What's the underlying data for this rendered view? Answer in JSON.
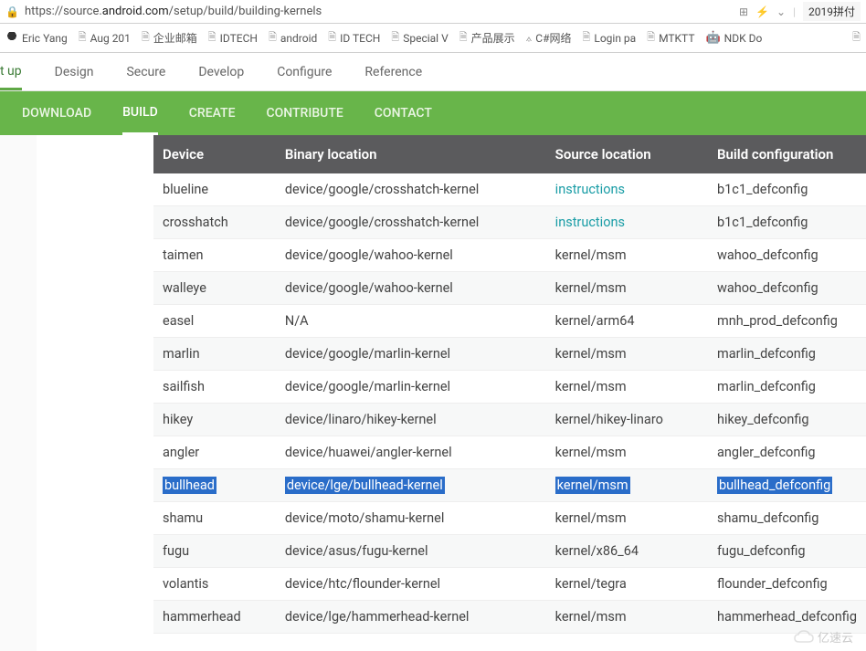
{
  "address_bar": {
    "url_prefix": "https://source.",
    "url_domain": "android.com",
    "url_suffix": "/setup/build/building-kernels",
    "right_badge": "2019拼付"
  },
  "bookmarks": [
    {
      "label": "Eric Yang",
      "icon": "eric"
    },
    {
      "label": "Aug 201",
      "icon": "file"
    },
    {
      "label": "企业邮箱",
      "icon": "file"
    },
    {
      "label": "IDTECH",
      "icon": "file"
    },
    {
      "label": "android",
      "icon": "file"
    },
    {
      "label": "ID TECH",
      "icon": "file"
    },
    {
      "label": "Special V",
      "icon": "file"
    },
    {
      "label": "产品展示",
      "icon": "file"
    },
    {
      "label": "C#网络",
      "icon": "csharp"
    },
    {
      "label": "Login pa",
      "icon": "file"
    },
    {
      "label": "MTKTT",
      "icon": "file"
    },
    {
      "label": "NDK Do",
      "icon": "android"
    }
  ],
  "site_nav": [
    "t up",
    "Design",
    "Secure",
    "Develop",
    "Configure",
    "Reference"
  ],
  "site_nav_active_index": 0,
  "green_nav": [
    "DOWNLOAD",
    "BUILD",
    "CREATE",
    "CONTRIBUTE",
    "CONTACT"
  ],
  "green_nav_active_index": 1,
  "table": {
    "headers": [
      "Device",
      "Binary location",
      "Source location",
      "Build configuration"
    ],
    "rows": [
      {
        "device": "blueline",
        "binary": "device/google/crosshatch-kernel",
        "source": "instructions",
        "source_is_link": true,
        "build": "b1c1_defconfig",
        "highlight": false
      },
      {
        "device": "crosshatch",
        "binary": "device/google/crosshatch-kernel",
        "source": "instructions",
        "source_is_link": true,
        "build": "b1c1_defconfig",
        "highlight": false
      },
      {
        "device": "taimen",
        "binary": "device/google/wahoo-kernel",
        "source": "kernel/msm",
        "source_is_link": false,
        "build": "wahoo_defconfig",
        "highlight": false
      },
      {
        "device": "walleye",
        "binary": "device/google/wahoo-kernel",
        "source": "kernel/msm",
        "source_is_link": false,
        "build": "wahoo_defconfig",
        "highlight": false
      },
      {
        "device": "easel",
        "binary": "N/A",
        "source": "kernel/arm64",
        "source_is_link": false,
        "build": "mnh_prod_defconfig",
        "highlight": false
      },
      {
        "device": "marlin",
        "binary": "device/google/marlin-kernel",
        "source": "kernel/msm",
        "source_is_link": false,
        "build": "marlin_defconfig",
        "highlight": false
      },
      {
        "device": "sailfish",
        "binary": "device/google/marlin-kernel",
        "source": "kernel/msm",
        "source_is_link": false,
        "build": "marlin_defconfig",
        "highlight": false
      },
      {
        "device": "hikey",
        "binary": "device/linaro/hikey-kernel",
        "source": "kernel/hikey-linaro",
        "source_is_link": false,
        "build": "hikey_defconfig",
        "highlight": false
      },
      {
        "device": "angler",
        "binary": "device/huawei/angler-kernel",
        "source": "kernel/msm",
        "source_is_link": false,
        "build": "angler_defconfig",
        "highlight": false
      },
      {
        "device": "bullhead",
        "binary": "device/lge/bullhead-kernel",
        "source": "kernel/msm",
        "source_is_link": false,
        "build": "bullhead_defconfig",
        "highlight": true
      },
      {
        "device": "shamu",
        "binary": "device/moto/shamu-kernel",
        "source": "kernel/msm",
        "source_is_link": false,
        "build": "shamu_defconfig",
        "highlight": false
      },
      {
        "device": "fugu",
        "binary": "device/asus/fugu-kernel",
        "source": "kernel/x86_64",
        "source_is_link": false,
        "build": "fugu_defconfig",
        "highlight": false
      },
      {
        "device": "volantis",
        "binary": "device/htc/flounder-kernel",
        "source": "kernel/tegra",
        "source_is_link": false,
        "build": "flounder_defconfig",
        "highlight": false
      },
      {
        "device": "hammerhead",
        "binary": "device/lge/hammerhead-kernel",
        "source": "kernel/msm",
        "source_is_link": false,
        "build": "hammerhead_defconfig",
        "highlight": false
      }
    ]
  },
  "watermark": "亿速云"
}
